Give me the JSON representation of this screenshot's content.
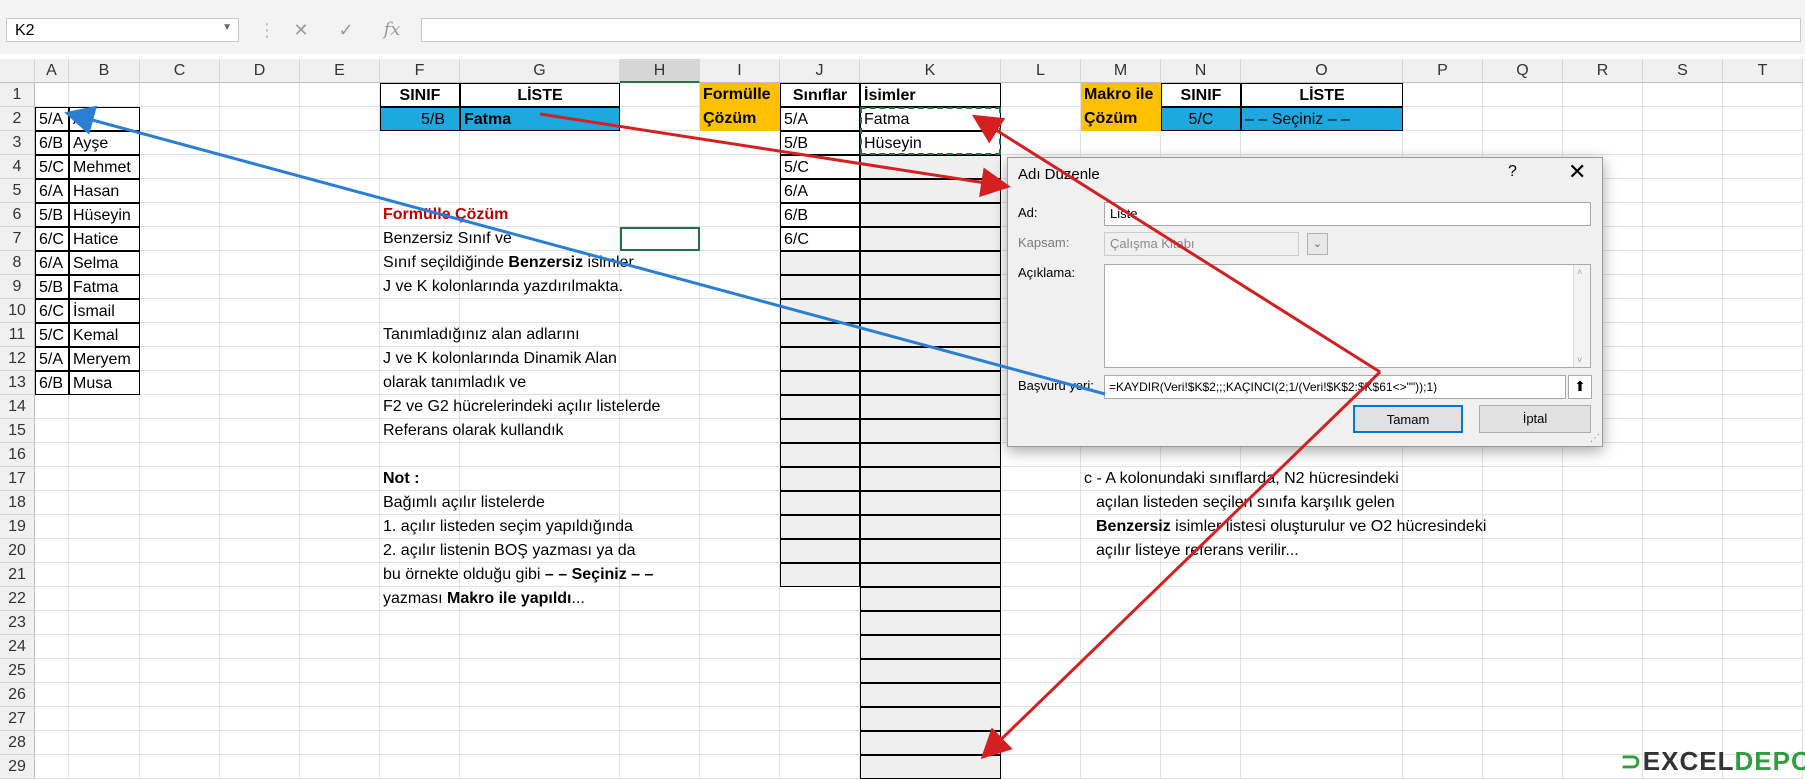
{
  "formula_bar": {
    "name_box": "K2",
    "cancel_icon": "✕",
    "enter_icon": "✓",
    "fx_icon": "fx"
  },
  "columns": [
    "A",
    "B",
    "C",
    "D",
    "E",
    "F",
    "G",
    "H",
    "I",
    "J",
    "K",
    "L",
    "M",
    "N",
    "O",
    "P",
    "Q",
    "R",
    "S",
    "T"
  ],
  "rows": [
    "1",
    "2",
    "3",
    "4",
    "5",
    "6",
    "7",
    "8",
    "9",
    "10",
    "11",
    "12",
    "13",
    "14",
    "15",
    "16",
    "17",
    "18",
    "19",
    "20",
    "21",
    "22",
    "23",
    "24",
    "25",
    "26",
    "27",
    "28",
    "29"
  ],
  "data_ab": [
    {
      "a": "5/A",
      "b": "Ali"
    },
    {
      "a": "6/B",
      "b": "Ayşe"
    },
    {
      "a": "5/C",
      "b": "Mehmet"
    },
    {
      "a": "6/A",
      "b": "Hasan"
    },
    {
      "a": "5/B",
      "b": "Hüseyin"
    },
    {
      "a": "6/C",
      "b": "Hatice"
    },
    {
      "a": "6/A",
      "b": "Selma"
    },
    {
      "a": "5/B",
      "b": "Fatma"
    },
    {
      "a": "6/C",
      "b": "İsmail"
    },
    {
      "a": "5/C",
      "b": "Kemal"
    },
    {
      "a": "5/A",
      "b": "Meryem"
    },
    {
      "a": "6/B",
      "b": "Musa"
    }
  ],
  "fg": {
    "sinif_header": "SINIF",
    "liste_header": "LİSTE",
    "sinif_value": "5/B",
    "liste_value": "Fatma"
  },
  "ij": {
    "formulle": "Formülle",
    "cozum": "Çözüm",
    "siniflar_header": "Sınıflar",
    "isimler_header": "İsimler",
    "siniflar": [
      "5/A",
      "5/B",
      "5/C",
      "6/A",
      "6/B",
      "6/C"
    ],
    "isimler": [
      "Fatma",
      "Hüseyin"
    ]
  },
  "mno": {
    "makro_ile": "Makro ile",
    "cozum": "Çözüm",
    "sinif_header": "SINIF",
    "liste_header": "LİSTE",
    "sinif_value": "5/C",
    "liste_value": "– – Seçiniz – –"
  },
  "notes_f": {
    "title": "Formülle  Çözüm",
    "l7": "Benzersiz Sınıf ve",
    "l8_a": "Sınıf seçildiğinde ",
    "l8_b": "Benzersiz",
    "l8_c": " isimler",
    "l9": "J ve K kolonlarında yazdırılmakta.",
    "l11": "Tanımladığınız alan adlarını",
    "l12": "J ve K kolonlarında Dinamik Alan",
    "l13": "olarak tanımladık ve",
    "l14": "F2 ve G2 hücrelerindeki açılır listelerde",
    "l15": "Referans olarak kullandık",
    "l17": "Not :",
    "l18": "Bağımlı açılır listelerde",
    "l19": "1. açılır listeden seçim yapıldığında",
    "l20": "2. açılır listenin BOŞ yazması ya da",
    "l21_a": "bu örnekte olduğu gibi ",
    "l21_b": "– – Seçiniz – –",
    "l22_a": "yazması ",
    "l22_b": "Makro ile yapıldı",
    "l22_c": "..."
  },
  "notes_m": {
    "l17": "c - A kolonundaki sınıflarda, N2 hücresindeki",
    "l18": "açılan listeden seçilen sınıfa karşılık gelen",
    "l19_a": "Benzersiz",
    "l19_b": " isimler listesi oluşturulur ve O2 hücresindeki",
    "l20": "açılır listeye referans verilir..."
  },
  "dialog": {
    "title": "Adı Düzenle",
    "help": "?",
    "close": "✕",
    "ad_label": "Ad:",
    "ad_value": "Liste",
    "kapsam_label": "Kapsam:",
    "kapsam_value": "Çalışma Kitabı",
    "aciklama_label": "Açıklama:",
    "basvuru_label": "Başvuru yeri:",
    "basvuru_value": "=KAYDIR(Veri!$K$2;;;KAÇINCI(2;1/(Veri!$K$2:$K$61<>\"\"));1)",
    "ok": "Tamam",
    "cancel": "İptal"
  },
  "logo": {
    "text": "EXCEL",
    "suffix": "DEPO"
  },
  "colors": {
    "blue_fill": "#1ea8e0",
    "orange_fill": "#ffc000",
    "arrow_red": "#d42020",
    "arrow_blue": "#2a7fd4",
    "selection_green": "#217346"
  }
}
